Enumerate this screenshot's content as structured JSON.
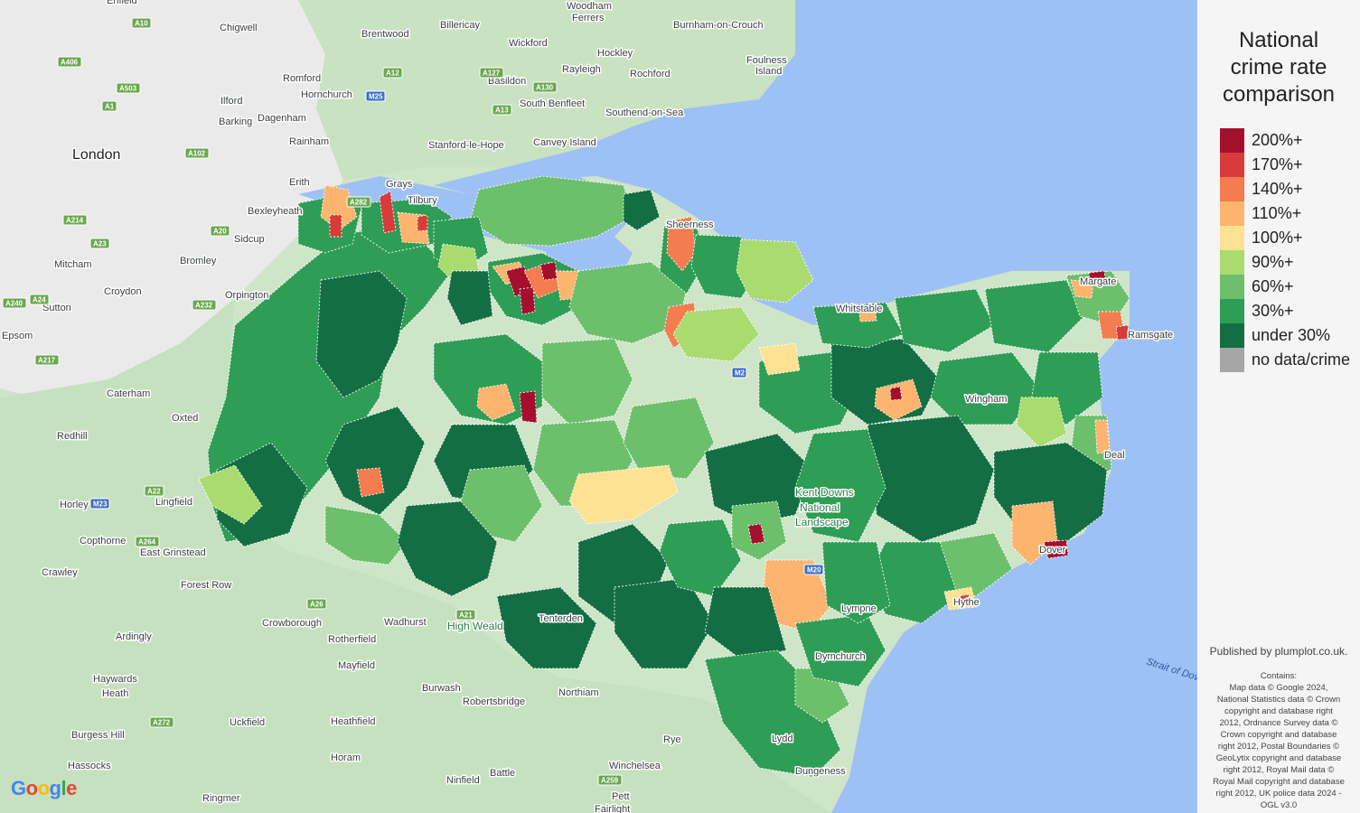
{
  "legend": {
    "title_lines": [
      "National",
      "crime rate",
      "comparison"
    ],
    "items": [
      {
        "label": "200%+",
        "color": "#a50f2e"
      },
      {
        "label": "170%+",
        "color": "#d73c3a"
      },
      {
        "label": "140%+",
        "color": "#f47c4e"
      },
      {
        "label": "110%+",
        "color": "#fdb46e"
      },
      {
        "label": "100%+",
        "color": "#fde294"
      },
      {
        "label": "90%+",
        "color": "#a9db6f"
      },
      {
        "label": "60%+",
        "color": "#6cbf6b"
      },
      {
        "label": "30%+",
        "color": "#2e9d55"
      },
      {
        "label": "under 30%",
        "color": "#136e43"
      },
      {
        "label": "no data/crime",
        "color": "#a6a6a6"
      }
    ]
  },
  "published": "Published by plumplot.co.uk.",
  "credits": [
    "Contains:",
    "Map data © Google 2024,",
    "National Statistics data © Crown",
    "copyright and database right",
    "2012, Ordnance Survey data ©",
    "Crown copyright and database",
    "right 2012, Postal Boundaries ©",
    "GeoLytix copyright and database",
    "right 2012, Royal Mail data ©",
    "Royal Mail copyright and database",
    "right 2012, UK police data 2024 -",
    "OGL v3.0"
  ],
  "google_logo": "Google",
  "places": [
    {
      "name": "London",
      "big": true
    },
    {
      "name": "Enfield"
    },
    {
      "name": "Chigwell"
    },
    {
      "name": "Brentwood"
    },
    {
      "name": "Billericay"
    },
    {
      "name": "Wickford"
    },
    {
      "name": "Woodham"
    },
    {
      "name": "Ferrers"
    },
    {
      "name": "Burnham-on-Crouch"
    },
    {
      "name": "Hockley"
    },
    {
      "name": "Rayleigh"
    },
    {
      "name": "Rochford"
    },
    {
      "name": "Foulness"
    },
    {
      "name": "Island"
    },
    {
      "name": "Romford"
    },
    {
      "name": "Hornchurch"
    },
    {
      "name": "Ilford"
    },
    {
      "name": "Barking"
    },
    {
      "name": "Dagenham"
    },
    {
      "name": "Basildon"
    },
    {
      "name": "South Benfleet"
    },
    {
      "name": "Southend-on-Sea"
    },
    {
      "name": "Rainham"
    },
    {
      "name": "Stanford-le-Hope"
    },
    {
      "name": "Canvey Island"
    },
    {
      "name": "Erith"
    },
    {
      "name": "Grays"
    },
    {
      "name": "Tilbury"
    },
    {
      "name": "Bexleyheath"
    },
    {
      "name": "Sidcup"
    },
    {
      "name": "Mitcham"
    },
    {
      "name": "Bromley"
    },
    {
      "name": "Croydon"
    },
    {
      "name": "Orpington"
    },
    {
      "name": "Sutton"
    },
    {
      "name": "Epsom"
    },
    {
      "name": "Caterham"
    },
    {
      "name": "Oxted"
    },
    {
      "name": "Redhill"
    },
    {
      "name": "Horley"
    },
    {
      "name": "Lingfield"
    },
    {
      "name": "Copthorne"
    },
    {
      "name": "East Grinstead"
    },
    {
      "name": "Crawley"
    },
    {
      "name": "Forest Row"
    },
    {
      "name": "Crowborough"
    },
    {
      "name": "Wadhurst"
    },
    {
      "name": "Rotherfield"
    },
    {
      "name": "Ardingly"
    },
    {
      "name": "Mayfield"
    },
    {
      "name": "Haywards"
    },
    {
      "name": "Heath"
    },
    {
      "name": "Burwash"
    },
    {
      "name": "Robertsbridge"
    },
    {
      "name": "Northiam"
    },
    {
      "name": "Heathfield"
    },
    {
      "name": "Uckfield"
    },
    {
      "name": "Burgess Hill"
    },
    {
      "name": "Hassocks"
    },
    {
      "name": "Horam"
    },
    {
      "name": "Battle"
    },
    {
      "name": "Winchelsea"
    },
    {
      "name": "Rye"
    },
    {
      "name": "Pett"
    },
    {
      "name": "Ninfield"
    },
    {
      "name": "Ringmer"
    },
    {
      "name": "Fairlight"
    },
    {
      "name": "Dymchurch"
    },
    {
      "name": "Lympne"
    },
    {
      "name": "Lydd"
    },
    {
      "name": "Dungeness"
    },
    {
      "name": "Wingham"
    },
    {
      "name": "Whitstable"
    },
    {
      "name": "Tenterden"
    },
    {
      "name": "Sheerness"
    },
    {
      "name": "Margate"
    },
    {
      "name": "Ramsgate"
    },
    {
      "name": "Deal"
    },
    {
      "name": "Dover"
    },
    {
      "name": "Hythe"
    },
    {
      "name": "Kent Downs"
    },
    {
      "name": "National"
    },
    {
      "name": "Landscape"
    },
    {
      "name": "High Weald"
    },
    {
      "name": "Strait of Dover",
      "water": true
    }
  ],
  "roads": [
    "A10",
    "A12",
    "A406",
    "A503",
    "A1",
    "A127",
    "A130",
    "A13",
    "M25",
    "A102",
    "A282",
    "A214",
    "A23",
    "A20",
    "A240",
    "A24",
    "A232",
    "A217",
    "A22",
    "M23",
    "A264",
    "A26",
    "A21",
    "A272",
    "A259",
    "M20",
    "M2"
  ]
}
